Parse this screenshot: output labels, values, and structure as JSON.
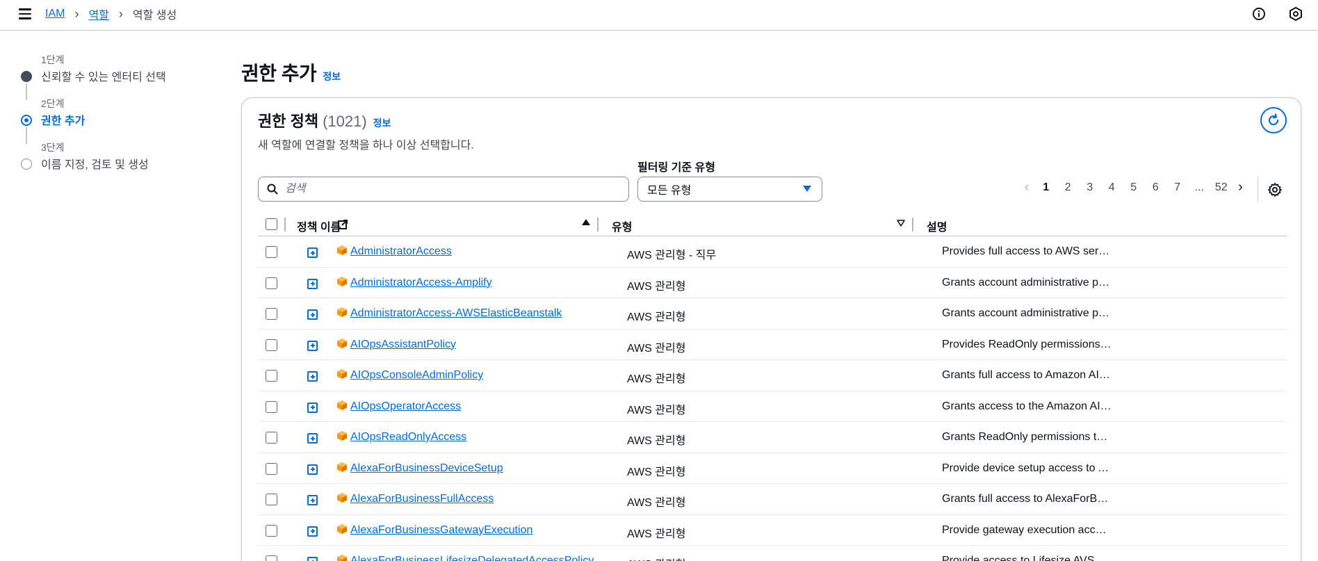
{
  "breadcrumbs": {
    "iam": "IAM",
    "roles": "역할",
    "current": "역할 생성"
  },
  "steps": [
    {
      "num": "1단계",
      "title": "신뢰할 수 있는 엔터티 선택",
      "state": "done"
    },
    {
      "num": "2단계",
      "title": "권한 추가",
      "state": "active"
    },
    {
      "num": "3단계",
      "title": "이름 지정, 검토 및 생성",
      "state": "todo"
    }
  ],
  "page": {
    "title": "권한 추가",
    "info": "정보"
  },
  "panel": {
    "title": "권한 정책",
    "count": "(1021)",
    "info": "정보",
    "description": "새 역할에 연결할 정책을 하나 이상 선택합니다."
  },
  "filter": {
    "search_placeholder": "검색",
    "type_label": "필터링 기준 유형",
    "type_value": "모든 유형"
  },
  "pagination": {
    "pages": [
      "1",
      "2",
      "3",
      "4",
      "5",
      "6",
      "7",
      "...",
      "52"
    ],
    "current": "1"
  },
  "table": {
    "headers": {
      "name": "정책 이름",
      "type": "유형",
      "description": "설명"
    },
    "rows": [
      {
        "name": "AdministratorAccess",
        "type": "AWS 관리형 - 직무",
        "description": "Provides full access to AWS services and resources."
      },
      {
        "name": "AdministratorAccess-Amplify",
        "type": "AWS 관리형",
        "description": "Grants account administrative permissions while explicitly allowing direct access to resources needed by Amplify applications."
      },
      {
        "name": "AdministratorAccess-AWSElasticBeanstalk",
        "type": "AWS 관리형",
        "description": "Grants account administrative permissions. Explicitly allows developers and administrators to gain direct access to resources."
      },
      {
        "name": "AIOpsAssistantPolicy",
        "type": "AWS 관리형",
        "description": "Provides ReadOnly permissions required by the AIOps Assistant."
      },
      {
        "name": "AIOpsConsoleAdminPolicy",
        "type": "AWS 관리형",
        "description": "Grants full access to Amazon AI Operations."
      },
      {
        "name": "AIOpsOperatorAccess",
        "type": "AWS 관리형",
        "description": "Grants access to the Amazon AI Operations."
      },
      {
        "name": "AIOpsReadOnlyAccess",
        "type": "AWS 관리형",
        "description": "Grants ReadOnly permissions to the Amazon AI Operations."
      },
      {
        "name": "AlexaForBusinessDeviceSetup",
        "type": "AWS 관리형",
        "description": "Provide device setup access to AlexaForBusiness services"
      },
      {
        "name": "AlexaForBusinessFullAccess",
        "type": "AWS 관리형",
        "description": "Grants full access to AlexaForBusiness resources and access to related AWS Services"
      },
      {
        "name": "AlexaForBusinessGatewayExecution",
        "type": "AWS 관리형",
        "description": "Provide gateway execution access to AlexaForBusiness services"
      },
      {
        "name": "AlexaForBusinessLifesizeDelegatedAccessPolicy",
        "type": "AWS 관리형",
        "description": "Provide access to Lifesize AVS devices"
      }
    ]
  },
  "colors": {
    "link": "#006ce0",
    "border": "#c6c6cd",
    "aws_orange": "#ff9900"
  },
  "icons": {
    "menu": "hamburger-icon",
    "info": "info-circle-icon",
    "notifications": "hex-shield-icon",
    "refresh": "refresh-icon",
    "settings": "gear-icon",
    "search": "search-icon",
    "external": "external-link-icon",
    "sort": "sort-ascending-icon",
    "aws": "aws-managed-cube-icon"
  }
}
